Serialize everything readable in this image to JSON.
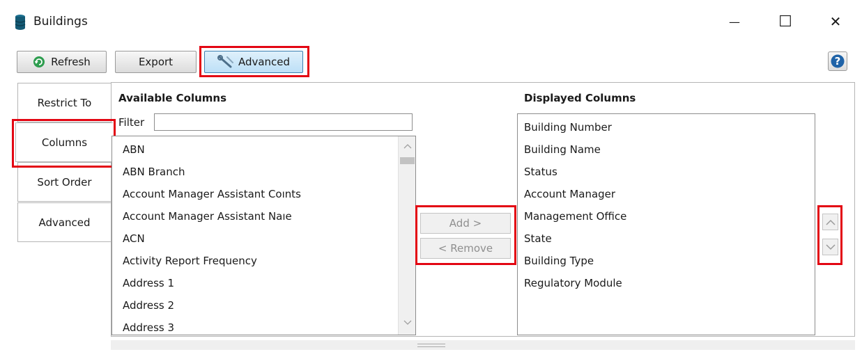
{
  "window": {
    "title": "Buildings",
    "minimize_glyph": "—",
    "maximize_glyph": "☐",
    "close_glyph": "✕"
  },
  "toolbar": {
    "refresh_label": "Refresh",
    "export_label": "Export",
    "advanced_label": "Advanced",
    "help_glyph": "?"
  },
  "tabs": [
    {
      "label": "Restrict To"
    },
    {
      "label": "Columns"
    },
    {
      "label": "Sort Order"
    },
    {
      "label": "Advanced"
    }
  ],
  "available": {
    "heading": "Available Columns",
    "filter_label": "Filter",
    "filter_value": "",
    "items": [
      "ABN",
      "ABN Branch",
      "Account Manager Assistant Coınts",
      "Account Manager Assistant Naıe",
      "ACN",
      "Activity Report Frequency",
      "Address 1",
      "Address 2",
      "Address 3"
    ]
  },
  "buttons": {
    "add_label": "Add >",
    "remove_label": "< Remove"
  },
  "displayed": {
    "heading": "Displayed Columns",
    "items": [
      "Building Number",
      "Building Name",
      "Status",
      "Account Manager",
      "Management Office",
      "State",
      "Building Type",
      "Regulatory Module"
    ]
  },
  "colors": {
    "highlight": "#e30613",
    "accent": "#3c7fb1",
    "help_blue": "#1f63a8",
    "refresh_green": "#2e9d4f"
  },
  "icons": {
    "app": "database-icon",
    "refresh": "refresh-icon",
    "advanced": "wrench-icon",
    "help": "help-icon"
  }
}
